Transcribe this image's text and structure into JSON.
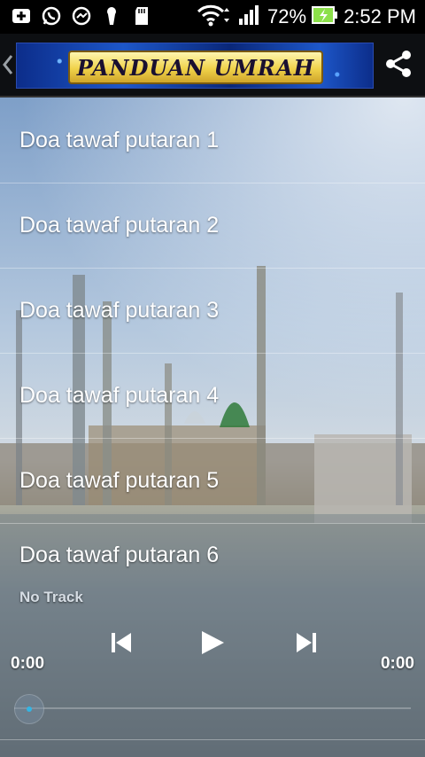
{
  "status_bar": {
    "battery_percent": "72%",
    "time": "2:52 PM",
    "icons": [
      "add-notification-icon",
      "whatsapp-icon",
      "chat-icon",
      "keyhole-icon",
      "sd-card-icon",
      "wifi-icon",
      "signal-icon",
      "battery-charging-icon"
    ]
  },
  "action_bar": {
    "banner_title": "PANDUAN UMRAH",
    "share_icon": "share-icon",
    "back_icon": "chevron-left-icon"
  },
  "list": {
    "items": [
      "Doa tawaf putaran 1",
      "Doa tawaf putaran 2",
      "Doa tawaf putaran 3",
      "Doa tawaf putaran 4",
      "Doa tawaf putaran 5",
      "Doa tawaf putaran 6"
    ]
  },
  "player": {
    "track": "No Track",
    "elapsed": "0:00",
    "duration": "0:00",
    "progress": 0,
    "controls": [
      "previous-icon",
      "play-icon",
      "next-icon"
    ]
  },
  "colors": {
    "accent": "#33b5e5",
    "banner_gold": "#f0d24a",
    "banner_blue": "#1d57c9"
  }
}
